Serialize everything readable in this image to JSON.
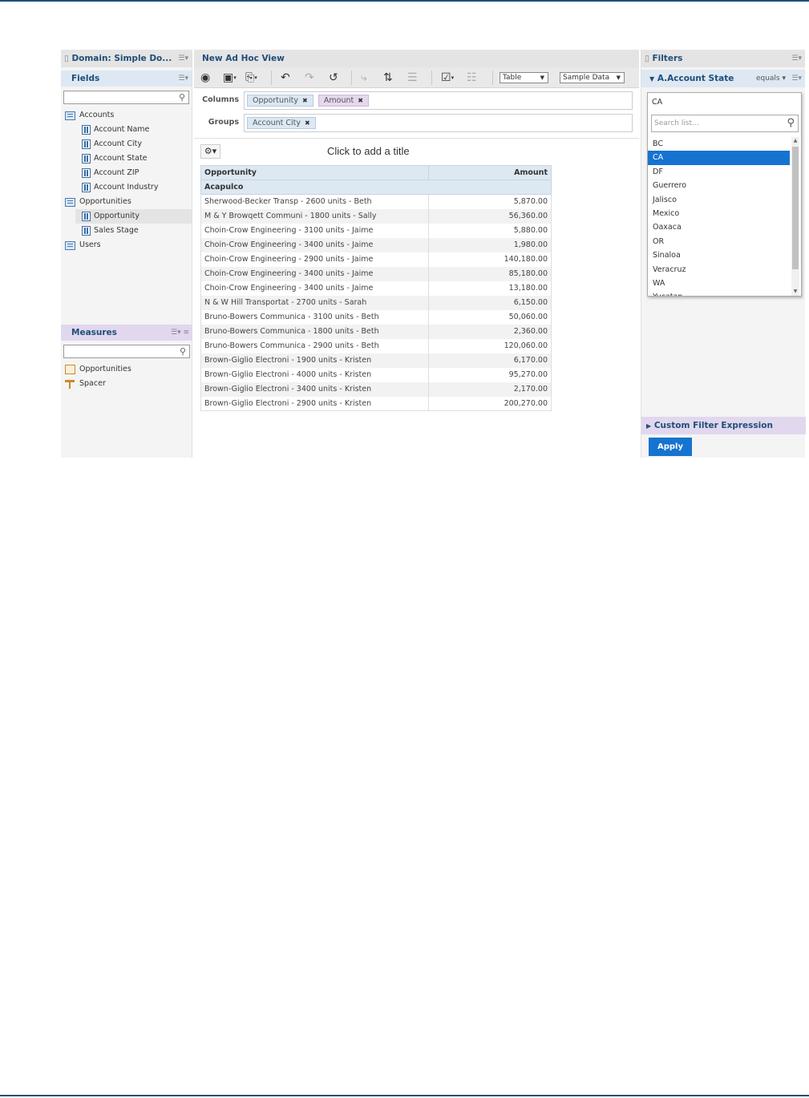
{
  "left": {
    "domain_title": "Domain: Simple Do...",
    "fields_title": "Fields",
    "fields_search": "",
    "tree": [
      {
        "label": "Accounts",
        "children": [
          "Account Name",
          "Account City",
          "Account State",
          "Account ZIP",
          "Account Industry"
        ]
      },
      {
        "label": "Opportunities",
        "children": [
          "Opportunity",
          "Sales Stage"
        ]
      },
      {
        "label": "Users",
        "children": []
      }
    ],
    "measures_title": "Measures",
    "measures_search": "",
    "measures": [
      "Opportunities",
      "Spacer"
    ]
  },
  "center": {
    "title": "New Ad Hoc View",
    "view_type": "Table",
    "data_mode": "Sample Data",
    "columns_label": "Columns",
    "groups_label": "Groups",
    "columns": [
      "Opportunity",
      "Amount"
    ],
    "groups": [
      "Account City"
    ],
    "add_title": "Click to add a title",
    "table": {
      "headers": [
        "Opportunity",
        "Amount"
      ],
      "group": "Acapulco",
      "rows": [
        [
          "Sherwood-Becker Transp - 2600 units - Beth",
          "5,870.00"
        ],
        [
          "M & Y Browqett Communi - 1800 units - Sally",
          "56,360.00"
        ],
        [
          "Choin-Crow Engineering - 3100 units - Jaime",
          "5,880.00"
        ],
        [
          "Choin-Crow Engineering - 3400 units - Jaime",
          "1,980.00"
        ],
        [
          "Choin-Crow Engineering - 2900 units - Jaime",
          "140,180.00"
        ],
        [
          "Choin-Crow Engineering - 3400 units - Jaime",
          "85,180.00"
        ],
        [
          "Choin-Crow Engineering - 3400 units - Jaime",
          "13,180.00"
        ],
        [
          "N & W Hill Transportat - 2700 units - Sarah",
          "6,150.00"
        ],
        [
          "Bruno-Bowers Communica - 3100 units - Beth",
          "50,060.00"
        ],
        [
          "Bruno-Bowers Communica - 1800 units - Beth",
          "2,360.00"
        ],
        [
          "Bruno-Bowers Communica - 2900 units - Beth",
          "120,060.00"
        ],
        [
          "Brown-Giglio Electroni - 1900 units - Kristen",
          "6,170.00"
        ],
        [
          "Brown-Giglio Electroni - 4000 units - Kristen",
          "95,270.00"
        ],
        [
          "Brown-Giglio Electroni - 3400 units - Kristen",
          "2,170.00"
        ],
        [
          "Brown-Giglio Electroni - 2900 units - Kristen",
          "200,270.00"
        ]
      ]
    }
  },
  "right": {
    "title": "Filters",
    "filter_name": "A.Account State",
    "operator": "equals",
    "value": "CA",
    "search_placeholder": "Search list...",
    "options": [
      "BC",
      "CA",
      "DF",
      "Guerrero",
      "Jalisco",
      "Mexico",
      "Oaxaca",
      "OR",
      "Sinaloa",
      "Veracruz",
      "WA",
      "Yucatan"
    ],
    "selected_option": "CA",
    "custom_expression": "Custom Filter Expression",
    "apply_label": "Apply"
  },
  "colors": {
    "brand": "#1f4e79",
    "selection": "#1673cf",
    "fields_header": "#dde8f2",
    "measures_header": "#e1d7ee"
  }
}
